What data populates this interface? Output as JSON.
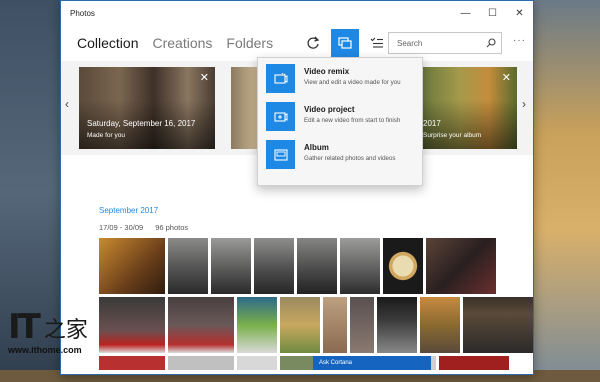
{
  "window": {
    "title": "Photos"
  },
  "window_controls": [
    "—",
    "☐",
    "✕"
  ],
  "tabs": [
    {
      "label": "Collection",
      "active": true
    },
    {
      "label": "Creations",
      "active": false
    },
    {
      "label": "Folders",
      "active": false
    }
  ],
  "toolbar": {
    "icons": [
      "refresh-icon",
      "create-icon",
      "select-icon"
    ],
    "active_icon": "create-icon"
  },
  "search": {
    "placeholder": "Search"
  },
  "more_label": "···",
  "hero": {
    "left_card": {
      "title": "Saturday, September 16, 2017",
      "subtitle": "Made for you"
    },
    "right_card": {
      "title": "2017",
      "subtitle": "Surprise your album"
    }
  },
  "create_menu": [
    {
      "title": "Video remix",
      "desc": "View and edit a video made for you",
      "icon": "video-remix-icon"
    },
    {
      "title": "Video project",
      "desc": "Edit a new video from start to finish",
      "icon": "video-project-icon"
    },
    {
      "title": "Album",
      "desc": "Gather related photos and videos",
      "icon": "album-icon"
    }
  ],
  "collection": {
    "month": "September 2017",
    "range": "17/09 - 30/09",
    "count": "96 photos"
  },
  "ad_bar": "Ask Cortana",
  "watermark": {
    "logo_text": "IT",
    "logo_cn": "之家",
    "url": "www.ithome.com"
  },
  "colors": {
    "accent": "#1e88e5",
    "section_title": "#1e88e5"
  }
}
